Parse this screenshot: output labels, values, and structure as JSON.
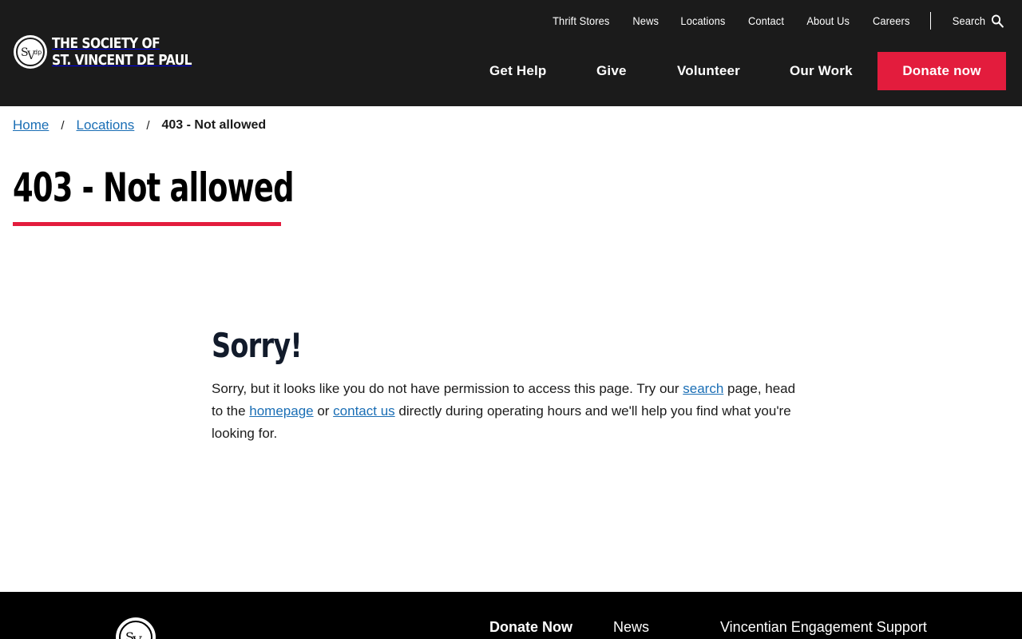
{
  "header": {
    "logo_line1": "THE SOCIETY OF",
    "logo_line2": "ST. VINCENT DE PAUL",
    "utility_nav": [
      "Thrift Stores",
      "News",
      "Locations",
      "Contact",
      "About Us",
      "Careers"
    ],
    "search_label": "Search",
    "main_nav": [
      "Get Help",
      "Give",
      "Volunteer",
      "Our Work"
    ],
    "donate_label": "Donate now",
    "donate_color": "#e31c3d",
    "background_color": "#1b1b1b"
  },
  "breadcrumb": {
    "home": "Home",
    "locations": "Locations",
    "current": "403 - Not allowed"
  },
  "page": {
    "title": "403 - Not allowed",
    "heading": "Sorry!",
    "message_part1": "Sorry, but it looks like you do not have permission to access this page. Try our ",
    "link_search": "search",
    "message_part2": " page, head to the ",
    "link_homepage": "homepage",
    "message_part3": " or ",
    "link_contact": "contact us",
    "message_part4": " directly during operating hours and we'll help you find what you're looking for.",
    "link_color": "#1a6eb5"
  },
  "footer": {
    "links": [
      "Donate Now",
      "News",
      "Vincentian Engagement Support"
    ]
  }
}
